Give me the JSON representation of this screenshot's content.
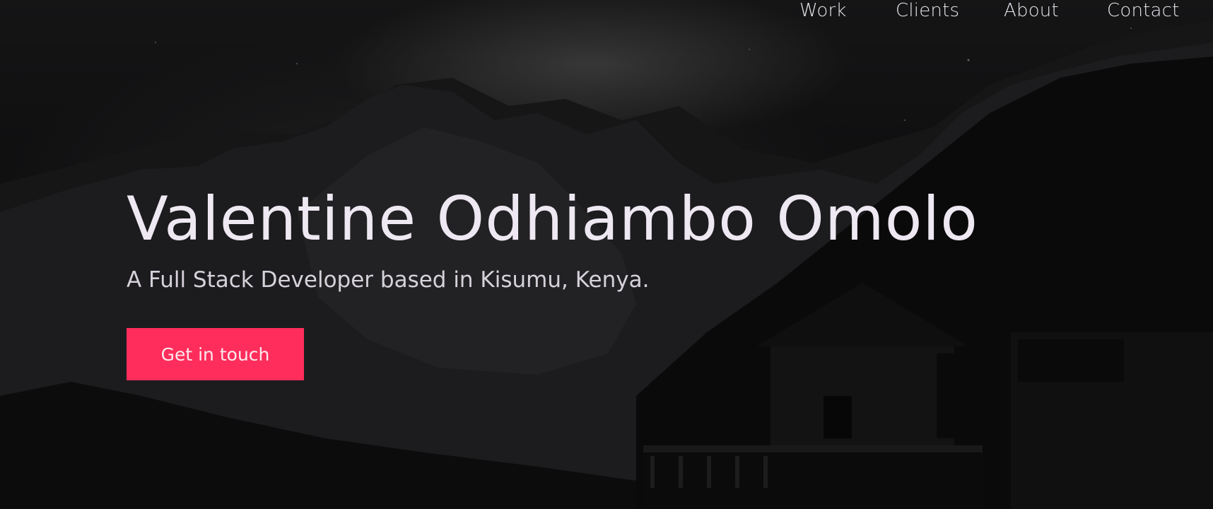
{
  "nav": {
    "items": [
      {
        "label": "Work"
      },
      {
        "label": "Clients"
      },
      {
        "label": "About"
      },
      {
        "label": "Contact"
      }
    ]
  },
  "hero": {
    "title": "Valentine Odhiambo Omolo",
    "subtitle": "A Full Stack Developer based in Kisumu, Kenya.",
    "cta_label": "Get in touch"
  },
  "colors": {
    "accent": "#ff2d5b",
    "text": "#eee8f2",
    "background": "#070708"
  }
}
